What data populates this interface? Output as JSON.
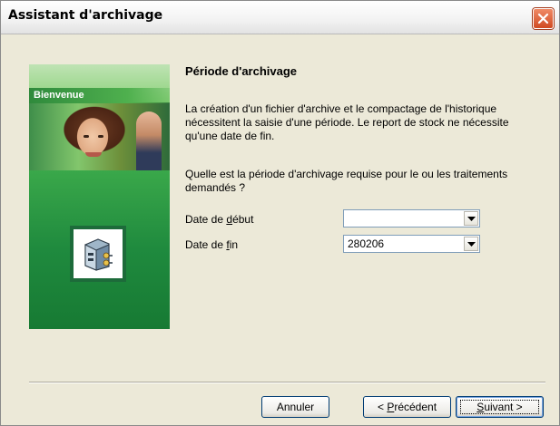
{
  "window": {
    "title": "Assistant d'archivage"
  },
  "side_panel": {
    "welcome_label": "Bienvenue",
    "icon": "archive-icon"
  },
  "main": {
    "heading": "Période d'archivage",
    "paragraph1": "La création d'un fichier d'archive et le compactage de l'historique nécessitent la saisie d'une période. Le report de stock ne nécessite qu'une date de fin.",
    "paragraph2": "Quelle est la période d'archivage requise pour le ou les traitements demandés ?",
    "fields": {
      "start": {
        "label_pre": "Date de ",
        "label_mnemonic": "d",
        "label_post": "ébut",
        "value": ""
      },
      "end": {
        "label_pre": "Date de ",
        "label_mnemonic": "f",
        "label_post": "in",
        "value": "280206"
      }
    }
  },
  "buttons": {
    "cancel": "Annuler",
    "previous": {
      "pre": "< ",
      "mnemonic": "P",
      "post": "récédent"
    },
    "next": {
      "mnemonic": "S",
      "post": "uivant >"
    }
  },
  "colors": {
    "close": "#d04a22",
    "panel_green": "#3aa84a",
    "icon_border": "#1d6b3a"
  }
}
